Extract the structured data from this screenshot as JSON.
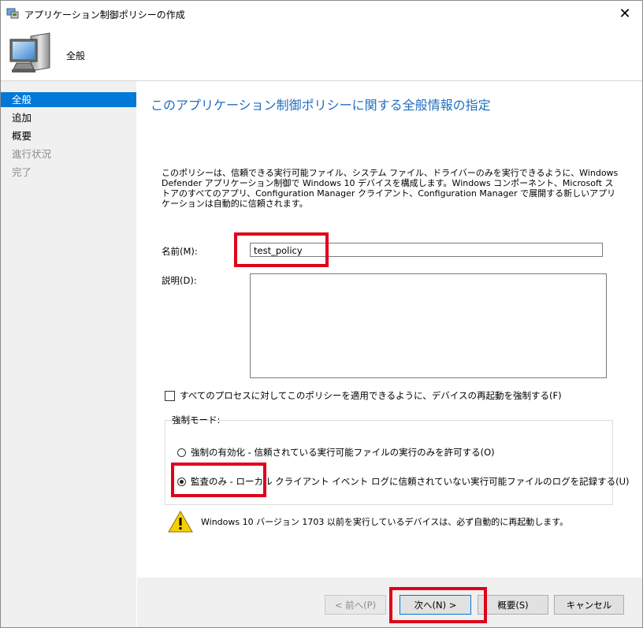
{
  "window": {
    "title": "アプリケーション制御ポリシーの作成",
    "close_glyph": "✕"
  },
  "header": {
    "title": "全般"
  },
  "sidebar": {
    "items": [
      {
        "label": "全般",
        "state": "active"
      },
      {
        "label": "追加",
        "state": "normal"
      },
      {
        "label": "概要",
        "state": "normal"
      },
      {
        "label": "進行状況",
        "state": "disabled"
      },
      {
        "label": "完了",
        "state": "disabled"
      }
    ]
  },
  "main": {
    "title": "このアプリケーション制御ポリシーに関する全般情報の指定",
    "description": "このポリシーは、信頼できる実行可能ファイル、システム ファイル、ドライバーのみを実行できるように、Windows Defender アプリケーション制御で Windows 10 デバイスを構成します。Windows コンポーネント、Microsoft ストアのすべてのアプリ、Configuration Manager クライアント、Configuration Manager で展開する新しいアプリケーションは自動的に信頼されます。",
    "name_label": "名前(M):",
    "name_value": "test_policy",
    "desc_label": "説明(D):",
    "desc_value": "",
    "restart_checkbox": {
      "label": "すべてのプロセスに対してこのポリシーを適用できるように、デバイスの再起動を強制する(F)",
      "checked": false
    },
    "enforcement": {
      "label": "強制モード:",
      "options": [
        {
          "label": "強制の有効化 - 信頼されている実行可能ファイルの実行のみを許可する(O)",
          "selected": false
        },
        {
          "label": "監査のみ - ローカル クライアント イベント ログに信頼されていない実行可能ファイルのログを記録する(U)",
          "selected": true
        }
      ]
    },
    "warning": "Windows 10 バージョン 1703 以前を実行しているデバイスは、必ず自動的に再起動します。"
  },
  "footer": {
    "prev_label": "< 前へ(P)",
    "next_label": "次へ(N) >",
    "summary_label": "概要(S)",
    "cancel_label": "キャンセル"
  },
  "colors": {
    "accent": "#0078d7",
    "highlight": "#e0001a",
    "title_blue": "#1f6fbf"
  }
}
